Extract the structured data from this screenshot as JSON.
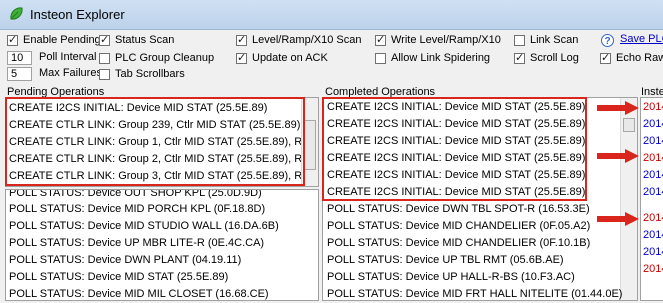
{
  "window": {
    "title": "Insteon Explorer",
    "icon": "leaf-icon"
  },
  "options": {
    "enable_pending": {
      "label": "Enable Pending",
      "checked": true
    },
    "status_scan": {
      "label": "Status Scan",
      "checked": true
    },
    "level_scan": {
      "label": "Level/Ramp/X10 Scan",
      "checked": true
    },
    "write_level": {
      "label": "Write Level/Ramp/X10",
      "checked": true
    },
    "link_scan": {
      "label": "Link Scan",
      "checked": false
    },
    "poll_interval": {
      "value": "10",
      "label": "Poll Interval"
    },
    "plc_group_cleanup": {
      "label": "PLC Group Cleanup",
      "checked": false
    },
    "update_on_ack": {
      "label": "Update on ACK",
      "checked": true
    },
    "allow_link_spidering": {
      "label": "Allow Link Spidering",
      "checked": false
    },
    "scroll_log": {
      "label": "Scroll Log",
      "checked": true
    },
    "echo_raw": {
      "label": "Echo Raw",
      "checked": true
    },
    "max_failures": {
      "value": "5",
      "label": "Max Failures"
    },
    "tab_scrollbars": {
      "label": "Tab Scrollbars",
      "checked": false
    }
  },
  "help": {
    "icon": "help-icon",
    "glyph": "?",
    "link": "Save PLC"
  },
  "colors": {
    "highlight": "#d9251c",
    "date_red": "#cc0000",
    "date_blue": "#0000cc"
  },
  "pending": {
    "heading": "Pending Operations",
    "rows": [
      "CREATE I2CS INITIAL: Device MID STAT (25.5E.89)",
      "CREATE CTLR LINK: Group 239, Ctlr MID STAT (25.5E.89), Re",
      "CREATE CTLR LINK: Group 1, Ctlr MID STAT (25.5E.89), Resp",
      "CREATE CTLR LINK: Group 2, Ctlr MID STAT (25.5E.89), Resp",
      "CREATE CTLR LINK: Group 3, Ctlr MID STAT (25.5E.89), Resp",
      "POLL STATUS: Device OUT SHOP KPL (25.0D.9D)",
      "POLL STATUS: Device MID PORCH KPL (0F.18.8D)",
      "POLL STATUS: Device MID STUDIO WALL (16.DA.6B)",
      "POLL STATUS: Device UP MBR LITE-R (0E.4C.CA)",
      "POLL STATUS: Device DWN PLANT (04.19.11)",
      "POLL STATUS: Device MID STAT (25.5E.89)",
      "POLL STATUS: Device MID MIL CLOSET (16.68.CE)"
    ]
  },
  "completed": {
    "heading": "Completed Operations",
    "rows": [
      "CREATE I2CS INITIAL: Device MID STAT (25.5E.89)",
      "CREATE I2CS INITIAL: Device MID STAT (25.5E.89)",
      "CREATE I2CS INITIAL: Device MID STAT (25.5E.89)",
      "CREATE I2CS INITIAL: Device MID STAT (25.5E.89)",
      "CREATE I2CS INITIAL: Device MID STAT (25.5E.89)",
      "CREATE I2CS INITIAL: Device MID STAT (25.5E.89)",
      "POLL STATUS: Device DWN TBL SPOT-R (16.53.3E)",
      "POLL STATUS: Device MID CHANDELIER (0F.05.A2)",
      "POLL STATUS: Device MID CHANDELIER (0F.10.1B)",
      "POLL STATUS: Device UP TBL RMT (05.6B.AE)",
      "POLL STATUS: Device UP HALL-R-BS (10.F3.AC)",
      "POLL STATUS: Device MID FRT HALL NITELITE (01.44.0E)"
    ]
  },
  "log": {
    "heading": "Inste",
    "rows": [
      {
        "text": "2014",
        "color": "red"
      },
      {
        "text": "2014",
        "color": "blue"
      },
      {
        "text": "2014",
        "color": "blue"
      },
      {
        "text": "2014",
        "color": "red"
      },
      {
        "text": "2014",
        "color": "blue"
      },
      {
        "text": "2014",
        "color": "blue"
      },
      {
        "text": "2014",
        "color": "red"
      },
      {
        "text": "2014",
        "color": "blue"
      },
      {
        "text": "2014",
        "color": "blue"
      },
      {
        "text": "2014",
        "color": "red"
      }
    ]
  }
}
